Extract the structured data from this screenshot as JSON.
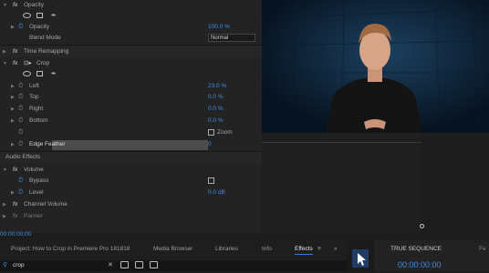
{
  "effect_controls": {
    "opacity": {
      "label": "Opacity",
      "opacity_label": "Opacity",
      "opacity_value": "100.0 %",
      "blend_label": "Blend Mode",
      "blend_value": "Normal"
    },
    "time_remapping": {
      "label": "Time Remapping"
    },
    "crop": {
      "label": "Crop",
      "left_label": "Left",
      "left_value": "23.0 %",
      "top_label": "Top",
      "top_value": "0.0 %",
      "right_label": "Right",
      "right_value": "0.0 %",
      "bottom_label": "Bottom",
      "bottom_value": "0.0 %",
      "zoom_label": "Zoom",
      "edge_label": "Edge Feather",
      "edge_value": "0"
    },
    "audio_effects": {
      "label": "Audio Effects"
    },
    "volume": {
      "label": "Volume",
      "bypass_label": "Bypass",
      "level_label": "Level",
      "level_value": "0.0 dB"
    },
    "channel_volume": {
      "label": "Channel Volume"
    },
    "panner": {
      "label": "Panner"
    },
    "timecode": "00:00:00:00"
  },
  "bottom_tabs": [
    "Project: How to Crop in Premiere Pro 181818",
    "Media Browser",
    "Libraries",
    "Info",
    "Effects",
    "≡",
    "»"
  ],
  "search": {
    "value": "crop"
  },
  "sequence": {
    "title": "TRUE SEQUENCE",
    "timecode": "00:00:00:00",
    "extra": "Fe"
  },
  "colors": {
    "accent_blue": "#3f8ce6",
    "panel_bg": "#232323"
  }
}
